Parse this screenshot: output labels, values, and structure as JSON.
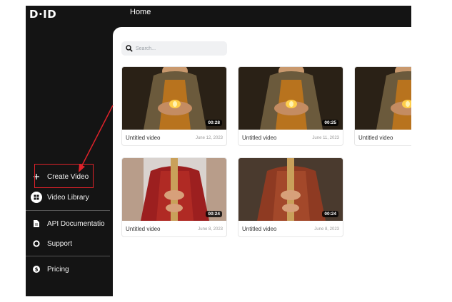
{
  "app": {
    "logo": "D·ID",
    "header_title": "Home"
  },
  "sidebar": {
    "items": [
      {
        "label": "Create Video",
        "icon": "plus-icon"
      },
      {
        "label": "Video Library",
        "icon": "grid-icon"
      },
      {
        "label": "API Documentatio",
        "icon": "document-icon"
      },
      {
        "label": "Support",
        "icon": "lifebuoy-icon"
      },
      {
        "label": "Pricing",
        "icon": "dollar-icon"
      }
    ]
  },
  "search": {
    "placeholder": "Search..."
  },
  "videos": [
    {
      "title": "Untitled video",
      "date": "June 12, 2023",
      "duration": "00:28",
      "thumbnail": "monk-with-candle"
    },
    {
      "title": "Untitled video",
      "date": "June 11, 2023",
      "duration": "00:25",
      "thumbnail": "monk-with-candle"
    },
    {
      "title": "Untitled video",
      "date": "",
      "duration": "",
      "thumbnail": "monk-with-candle"
    },
    {
      "title": "Untitled video",
      "date": "June 8, 2023",
      "duration": "00:24",
      "thumbnail": "monk-with-wooden-bar"
    },
    {
      "title": "Untitled video",
      "date": "June 8, 2023",
      "duration": "00:24",
      "thumbnail": "monk-with-wooden-bar"
    }
  ],
  "colors": {
    "sidebar_bg": "#141414",
    "annotation_red": "#e0222a"
  }
}
